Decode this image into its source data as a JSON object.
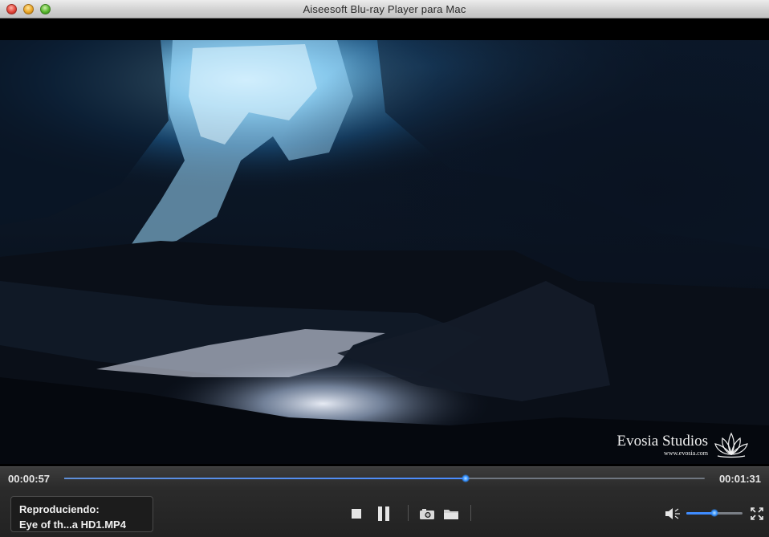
{
  "window": {
    "title": "Aiseesoft Blu-ray Player para Mac"
  },
  "video": {
    "watermark_brand": "Evosia Studios",
    "watermark_url": "www.evosia.com"
  },
  "playback": {
    "current_time": "00:00:57",
    "duration": "00:01:31",
    "progress_fraction": 0.626,
    "volume_fraction": 0.5
  },
  "now_playing": {
    "label": "Reproduciendo:",
    "filename": "Eye of th...a HD1.MP4"
  },
  "icons": {
    "stop": "stop-icon",
    "pause": "pause-icon",
    "snapshot": "camera-icon",
    "open": "folder-icon",
    "volume": "speaker-icon",
    "fullscreen": "fullscreen-icon",
    "logo": "lotus-icon"
  },
  "colors": {
    "accent": "#3f8cff",
    "control_bar": "#262626",
    "text": "#f0f0f0"
  }
}
